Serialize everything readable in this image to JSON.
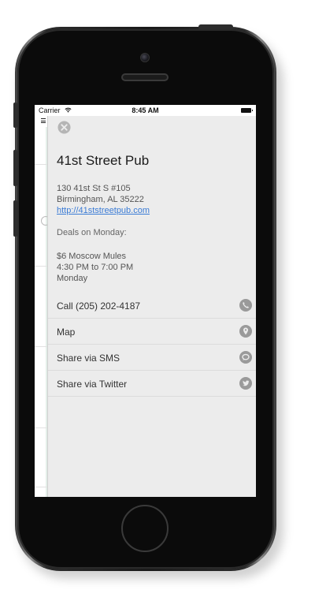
{
  "status_bar": {
    "carrier": "Carrier",
    "time": "8:45 AM"
  },
  "venue": {
    "name": "41st Street Pub",
    "address_line1": "130 41st St S #105",
    "address_line2": "Birmingham, AL 35222",
    "website": "http://41ststreetpub.com"
  },
  "deals": {
    "heading": "Deals on Monday:",
    "item_line1": "$6 Moscow Mules",
    "item_line2": "4:30 PM to 7:00 PM",
    "item_line3": "Monday"
  },
  "actions": [
    {
      "label": "Call (205) 202-4187",
      "icon": "phone-icon"
    },
    {
      "label": "Map",
      "icon": "map-pin-icon"
    },
    {
      "label": "Share via SMS",
      "icon": "chat-bubble-icon"
    },
    {
      "label": "Share via Twitter",
      "icon": "twitter-icon"
    }
  ],
  "colors": {
    "drawer_background": "#ececec",
    "link": "#3a7bd5",
    "icon_gray": "#9a9a9a"
  }
}
